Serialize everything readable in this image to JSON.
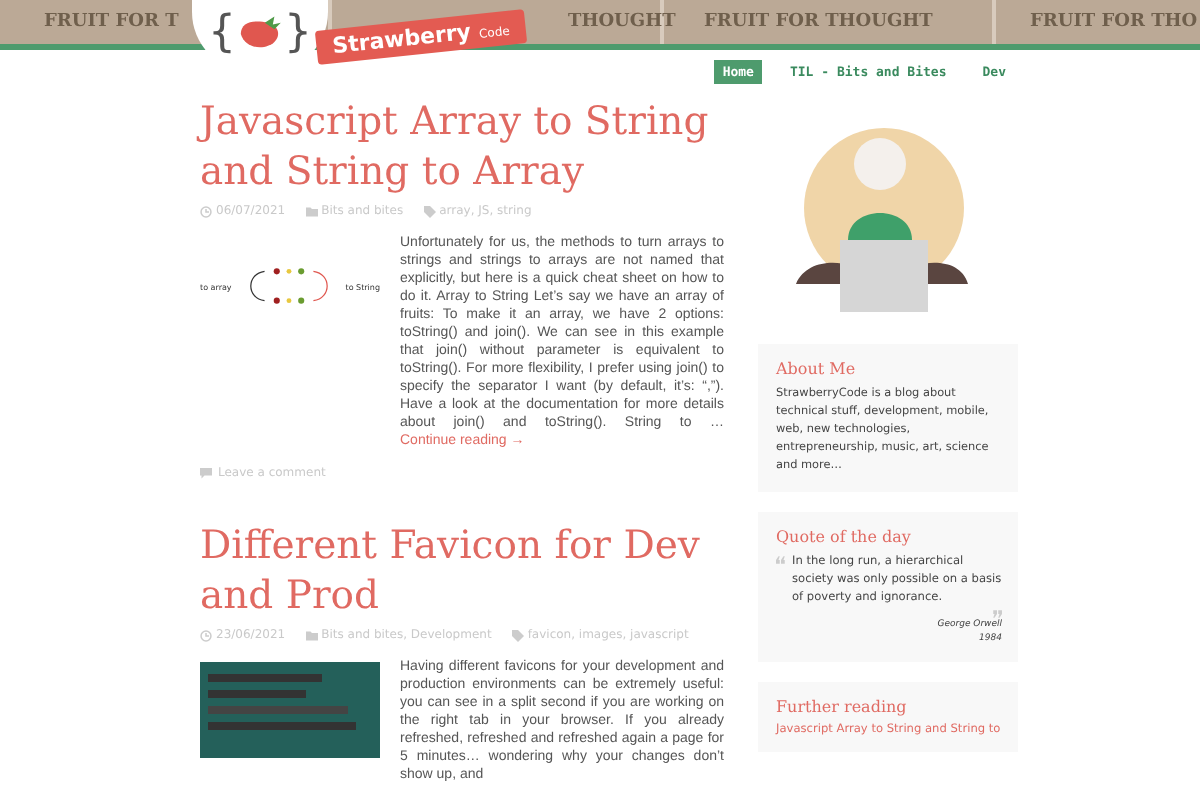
{
  "banner": {
    "texts": [
      "FRUIT FOR T",
      "THOUGHT",
      "FRUIT FOR THOUGHT",
      "FRUIT FOR THO"
    ]
  },
  "logo": {
    "brace_open": "{",
    "brace_close": "}",
    "name": "Strawberry",
    "suffix": "Code"
  },
  "nav": [
    {
      "label": "Home",
      "selected": true
    },
    {
      "label": "TIL - Bits and Bites",
      "selected": false
    },
    {
      "label": "Dev",
      "selected": false
    }
  ],
  "posts": [
    {
      "title": "Javascript Array to String and String to Array",
      "date": "06/07/2021",
      "categories": "Bits and bites",
      "tags": "array, JS, string",
      "image": {
        "kind": "diagram",
        "labels": [
          "to array",
          "to String"
        ]
      },
      "excerpt": "Unfortunately for us, the methods to turn arrays to strings and strings to arrays are not named that explicitly, but here is a quick cheat sheet on how to do it. Array to String Let’s say we have an array of fruits: To make it an array, we have 2 options: toString() and join(). We can see in this example that join() without parameter is equivalent to toString(). For more flexibility, I prefer using join() to specify the separator I want (by default, it’s: “,”). Have a look at the documentation for more details about join() and toString(). String to …",
      "more": "Continue reading →",
      "comment": "Leave a comment"
    },
    {
      "title": "Different Favicon for Dev and Prod",
      "date": "23/06/2021",
      "categories": "Bits and bites, Development",
      "tags": "favicon, images, javascript",
      "image": {
        "kind": "screenshot"
      },
      "excerpt": "Having different favicons for your development and production environments can be extremely useful: you can see in a split second if you are working on the right tab in your browser. If you already refreshed, refreshed and refreshed again a page for 5 minutes… wondering why your changes don’t show up, and"
    }
  ],
  "sidebar": {
    "about": {
      "title": "About Me",
      "text": "StrawberryCode is a blog about technical stuff, development, mobile, web, new technologies, entrepreneurship, music, art, science and more…"
    },
    "quote": {
      "title": "Quote of the day",
      "text": "In the long run, a hierarchical society was only possible on a basis of poverty and ignorance.",
      "author": "George Orwell",
      "source": "1984"
    },
    "further": {
      "title": "Further reading",
      "links": [
        "Javascript Array to String and String to"
      ]
    }
  }
}
